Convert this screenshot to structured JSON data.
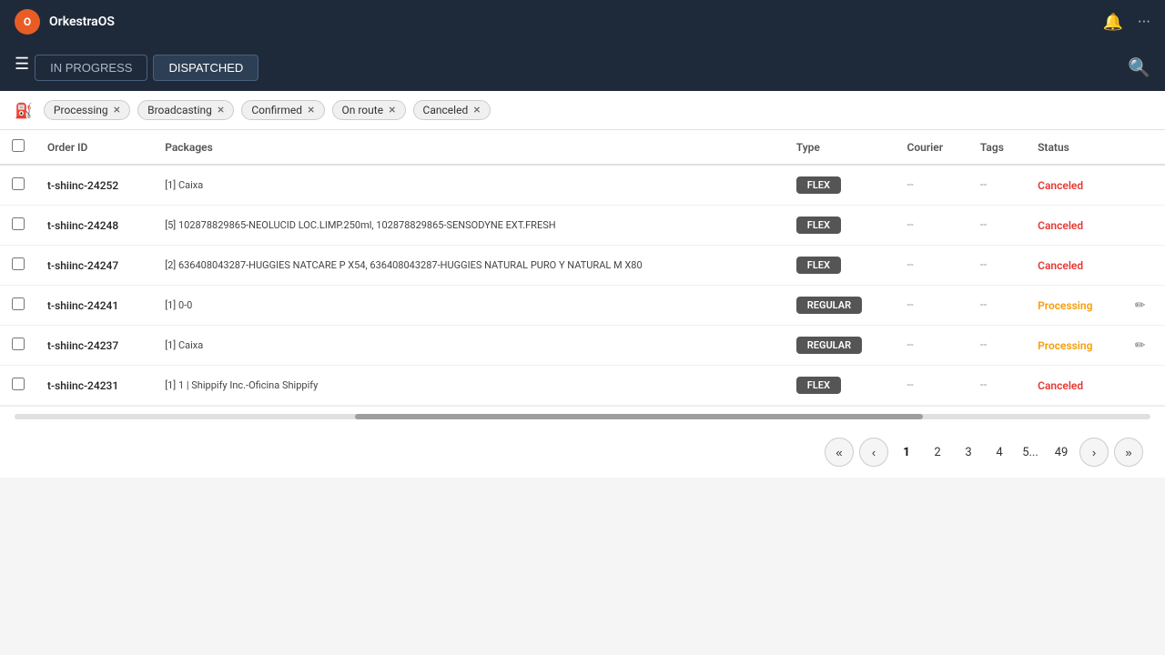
{
  "app": {
    "name": "OrkestraOS",
    "logo_text": "O"
  },
  "tabs": [
    {
      "id": "in-progress",
      "label": "IN PROGRESS",
      "active": false
    },
    {
      "id": "dispatched",
      "label": "DISPATCHED",
      "active": true
    }
  ],
  "filters": [
    {
      "id": "processing",
      "label": "Processing"
    },
    {
      "id": "broadcasting",
      "label": "Broadcasting"
    },
    {
      "id": "confirmed",
      "label": "Confirmed"
    },
    {
      "id": "on-route",
      "label": "On route"
    },
    {
      "id": "canceled",
      "label": "Canceled"
    }
  ],
  "columns": [
    {
      "id": "order-id",
      "label": "Order ID"
    },
    {
      "id": "packages",
      "label": "Packages"
    },
    {
      "id": "type",
      "label": "Type"
    },
    {
      "id": "courier",
      "label": "Courier"
    },
    {
      "id": "tags",
      "label": "Tags"
    },
    {
      "id": "status",
      "label": "Status"
    }
  ],
  "rows": [
    {
      "id": "t-shiinc-24252",
      "packages": "[1] Caixa",
      "type": "FLEX",
      "courier": "--",
      "tags": "--",
      "status": "Canceled",
      "status_type": "canceled",
      "editable": false
    },
    {
      "id": "t-shiinc-24248",
      "packages": "[5] 102878829865-NEOLUCID LOC.LIMP.250ml, 102878829865-SENSODYNE EXT.FRESH",
      "type": "FLEX",
      "courier": "--",
      "tags": "--",
      "status": "Canceled",
      "status_type": "canceled",
      "editable": false
    },
    {
      "id": "t-shiinc-24247",
      "packages": "[2] 636408043287-HUGGIES NATCARE P X54, 636408043287-HUGGIES NATURAL PURO Y NATURAL M X80",
      "type": "FLEX",
      "courier": "--",
      "tags": "--",
      "status": "Canceled",
      "status_type": "canceled",
      "editable": false
    },
    {
      "id": "t-shiinc-24241",
      "packages": "[1] 0-0",
      "type": "REGULAR",
      "courier": "--",
      "tags": "--",
      "status": "Processing",
      "status_type": "processing",
      "editable": true
    },
    {
      "id": "t-shiinc-24237",
      "packages": "[1] Caixa",
      "type": "REGULAR",
      "courier": "--",
      "tags": "--",
      "status": "Processing",
      "status_type": "processing",
      "editable": true
    },
    {
      "id": "t-shiinc-24231",
      "packages": "[1] 1 | Shippify Inc.-Oficina Shippify",
      "type": "FLEX",
      "courier": "--",
      "tags": "--",
      "status": "Canceled",
      "status_type": "canceled",
      "editable": false
    }
  ],
  "pagination": {
    "pages": [
      "1",
      "2",
      "3",
      "4",
      "5...",
      "49"
    ],
    "current": "1",
    "total": 49
  },
  "icons": {
    "menu": "☰",
    "bell": "🔔",
    "dots": "⋯",
    "search": "🔍",
    "filter": "⛾",
    "close": "×",
    "edit": "✏",
    "prev_prev": "«",
    "prev": "‹",
    "next": "›",
    "next_next": "»"
  }
}
